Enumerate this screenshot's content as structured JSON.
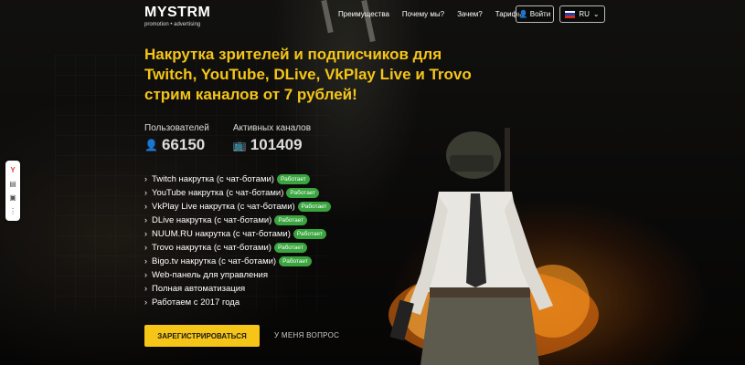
{
  "header": {
    "logo_title": "MYSTRM",
    "logo_subtitle": "promotion • advertising",
    "nav": [
      "Преимущества",
      "Почему мы?",
      "Зачем?",
      "Тарифы"
    ],
    "login_label": "Войти",
    "lang_label": "RU"
  },
  "hero": {
    "headline": "Накрутка зрителей и подписчиков для Twitch, YouTube, DLive, VkPlay Live и Trovo стрим каналов от 7 рублей!",
    "stats": [
      {
        "label": "Пользователей",
        "value": "66150",
        "icon": "user-icon"
      },
      {
        "label": "Активных каналов",
        "value": "101409",
        "icon": "tv-icon"
      }
    ],
    "features": [
      {
        "text": "Twitch накрутка (с чат-ботами)",
        "badge": "Работает"
      },
      {
        "text": "YouTube накрутка (с чат-ботами)",
        "badge": "Работает"
      },
      {
        "text": "VkPlay Live накрутка (с чат-ботами)",
        "badge": "Работает"
      },
      {
        "text": "DLive накрутка (с чат-ботами)",
        "badge": "Работает"
      },
      {
        "text": "NUUM.RU накрутка (с чат-ботами)",
        "badge": "Работает"
      },
      {
        "text": "Trovo накрутка (с чат-ботами)",
        "badge": "Работает"
      },
      {
        "text": "Bigo.tv накрутка (с чат-ботами)",
        "badge": "Работает"
      },
      {
        "text": "Web-панель для управления",
        "badge": ""
      },
      {
        "text": "Полная автоматизация",
        "badge": ""
      },
      {
        "text": "Работаем с 2017 года",
        "badge": ""
      }
    ],
    "register_label": "ЗАРЕГИСТРИРОВАТЬСЯ",
    "question_label": "У МЕНЯ ВОПРОС"
  },
  "sidepanel": {
    "logo_letter": "Y"
  },
  "colors": {
    "accent": "#f5c518",
    "badge_green": "#3aa43f"
  }
}
